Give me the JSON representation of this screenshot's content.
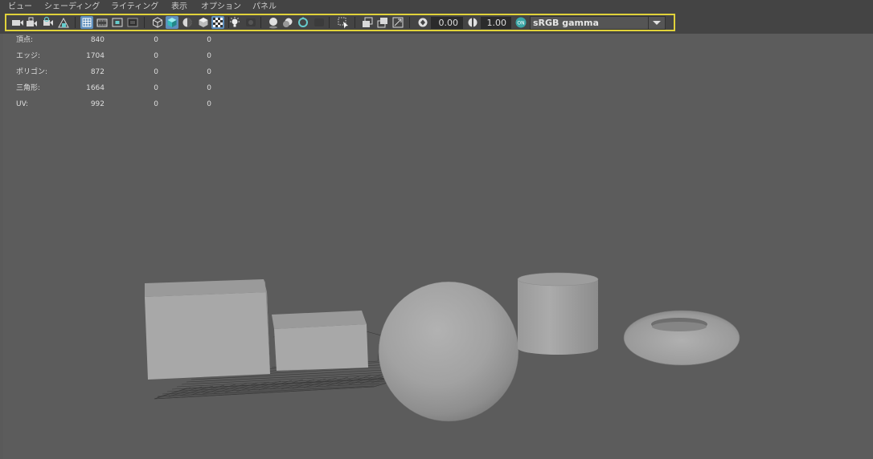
{
  "menu": [
    "ビュー",
    "シェーディング",
    "ライティング",
    "表示",
    "オプション",
    "パネル"
  ],
  "toolbar": {
    "icons": [
      "camera-icon",
      "camera-lock-icon",
      "camera-bookmark-icon",
      "image-plane-icon",
      "grid-icon",
      "film-gate-icon",
      "resolution-gate-icon",
      "gate-mask-icon",
      "wireframe-cube-icon",
      "smooth-shade-cube-icon",
      "xray-icon",
      "bounding-box-icon",
      "textured-icon",
      "light-icon",
      "shadow-icon",
      "depth-of-field-icon",
      "motion-blur-icon",
      "ambient-occlusion-icon",
      "antialias-icon",
      "isolate-select-icon",
      "xray-joints-icon",
      "xray-active-icon",
      "backface-icon",
      "exposure-icon",
      "gamma-icon",
      "color-management-icon"
    ],
    "exposure_value": "0.00",
    "gamma_value": "1.00",
    "color_space": "sRGB gamma"
  },
  "hud_stats": [
    {
      "label": "頂点:",
      "values": [
        "840",
        "0",
        "0"
      ]
    },
    {
      "label": "エッジ:",
      "values": [
        "1704",
        "0",
        "0"
      ]
    },
    {
      "label": "ポリゴン:",
      "values": [
        "872",
        "0",
        "0"
      ]
    },
    {
      "label": "三角形:",
      "values": [
        "1664",
        "0",
        "0"
      ]
    },
    {
      "label": "UV:",
      "values": [
        "992",
        "0",
        "0"
      ]
    }
  ],
  "colors": {
    "viewport_bg": "#5c5c5c",
    "toolbar_bg": "#444444",
    "highlight": "#e0d23a",
    "active_icon": "#5f8fbc",
    "cm_icon": "#3aa6a6"
  },
  "scene_objects": [
    "large-cube",
    "small-cube",
    "sphere",
    "cylinder",
    "torus",
    "ground-grid"
  ]
}
